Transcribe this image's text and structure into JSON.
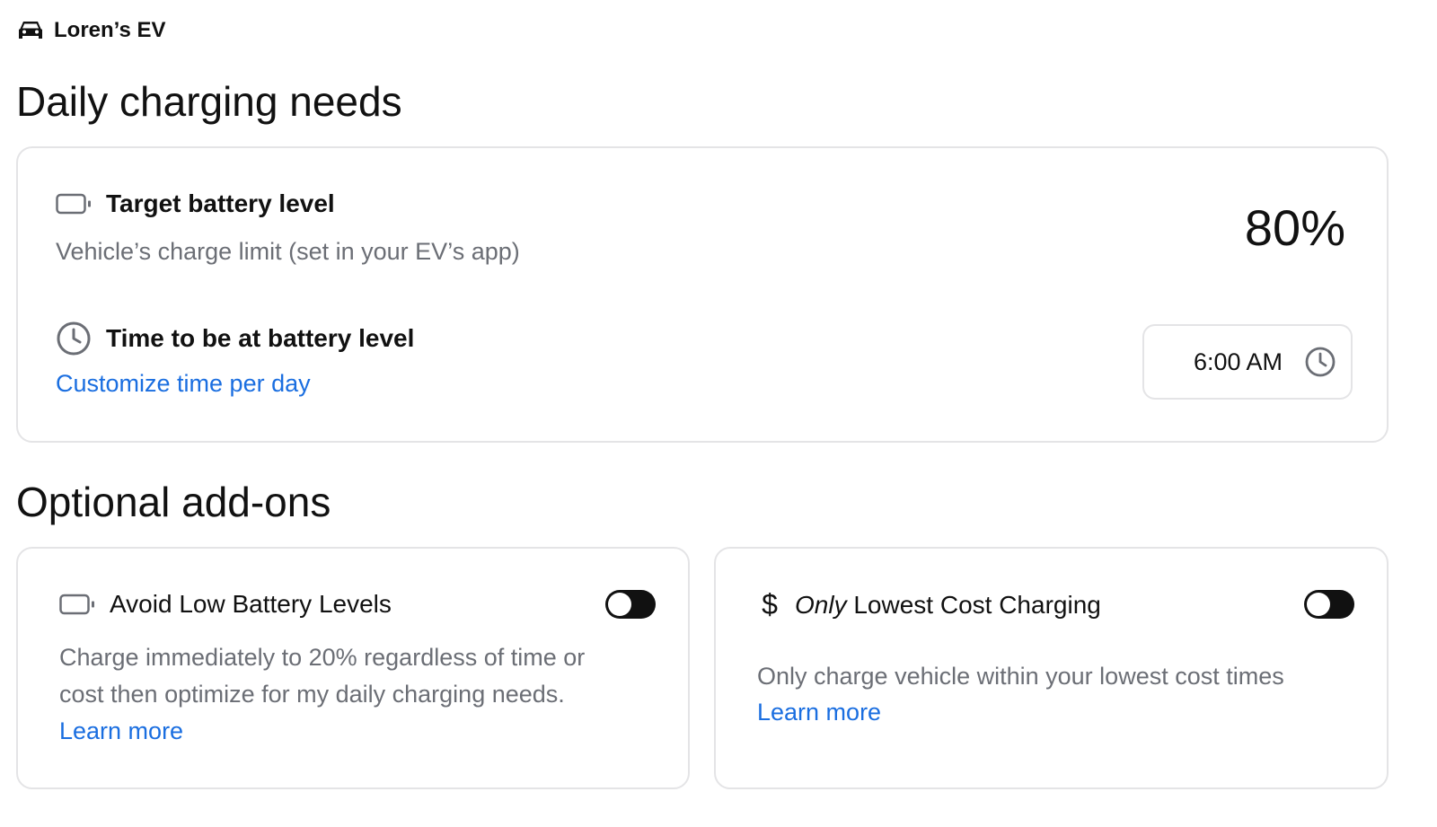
{
  "vehicle": {
    "name": "Loren’s EV",
    "icon": "car-icon"
  },
  "daily": {
    "title": "Daily charging needs",
    "target": {
      "icon": "battery-icon",
      "label": "Target battery level",
      "description": "Vehicle’s charge limit (set in your EV’s app)",
      "value": "80%"
    },
    "time": {
      "icon": "clock-icon",
      "label": "Time to be at battery level",
      "link": "Customize time per day",
      "value": "6:00 AM"
    }
  },
  "addons": {
    "title": "Optional add-ons",
    "avoid_low": {
      "icon": "battery-icon",
      "label": "Avoid Low Battery Levels",
      "description_line1": "Charge immediately to 20% regardless of time or",
      "description_line2": "cost then optimize for my daily charging needs.",
      "link": "Learn more",
      "enabled": false
    },
    "lowest_cost": {
      "icon": "dollar-icon",
      "label_italic": "Only",
      "label_rest": " Lowest Cost Charging",
      "description": "Only charge vehicle within your lowest cost times",
      "link": "Learn more",
      "enabled": false
    }
  },
  "colors": {
    "link": "#1a6ee0",
    "muted": "#6b6e75",
    "border": "#e4e4e6",
    "toggle": "#111111"
  }
}
